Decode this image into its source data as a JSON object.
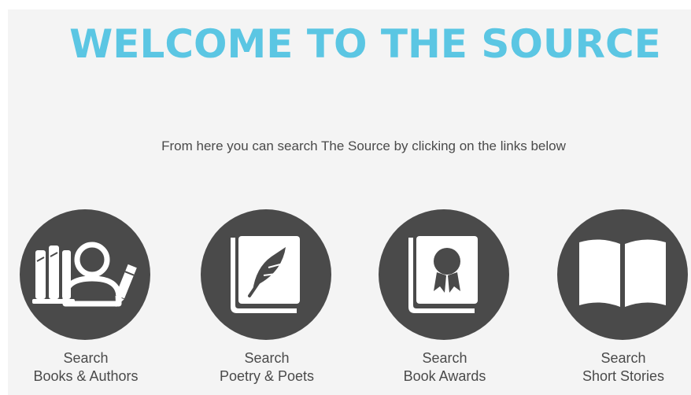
{
  "header": {
    "title": "WELCOME TO THE SOURCE",
    "intro": "From here you can search The Source by clicking on the links below"
  },
  "links": [
    {
      "line1": "Search",
      "line2": "Books & Authors",
      "icon": "books-authors-icon"
    },
    {
      "line1": "Search",
      "line2": "Poetry & Poets",
      "icon": "poetry-feather-book-icon"
    },
    {
      "line1": "Search",
      "line2": "Book Awards",
      "icon": "book-award-ribbon-icon"
    },
    {
      "line1": "Search",
      "line2": "Short Stories",
      "icon": "open-book-icon"
    }
  ],
  "colors": {
    "title": "#5bc6e3",
    "icon_circle": "#4a4a4a",
    "text": "#4a4a4a",
    "background": "#f4f4f4"
  }
}
